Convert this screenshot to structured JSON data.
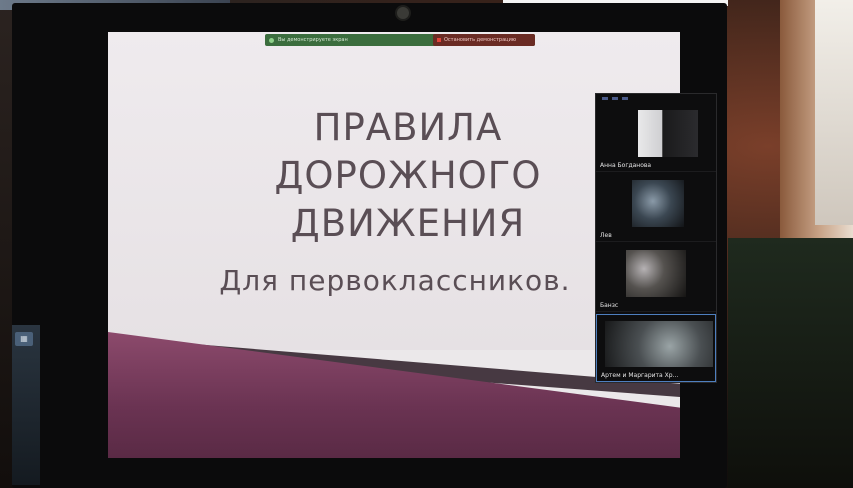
{
  "slide": {
    "title": "ПРАВИЛА\nДОРОЖНОГО\nДВИЖЕНИЯ",
    "subtitle": "Для первоклассников."
  },
  "toolbar": {
    "sharing_label": "Вы демонстрируете экран",
    "stop_label": "Остановить демонстрацию"
  },
  "participants": [
    {
      "name": "Анна Богданова"
    },
    {
      "name": "Лев"
    },
    {
      "name": "Банзс"
    },
    {
      "name": "Артем и Маргарита Хр..."
    }
  ],
  "colors": {
    "slide_text": "#5a4e55",
    "slide_accent": "#8c4a6c",
    "share_bar": "#3b6d3e",
    "stop_button": "#6a2b24",
    "active_speaker_border": "#4e7fbf"
  }
}
